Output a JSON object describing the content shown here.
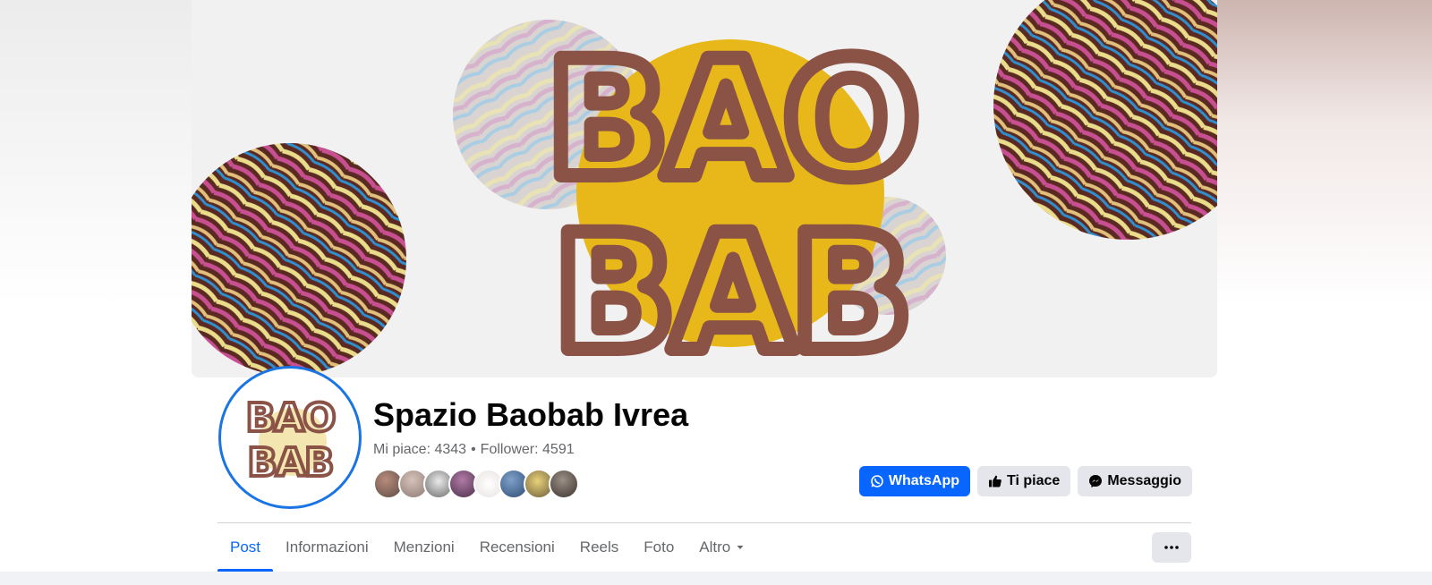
{
  "page": {
    "name": "Spazio Baobab Ivrea",
    "likes_label": "Mi piace: 4343",
    "followers_label": "Follower: 4591",
    "separator": "•"
  },
  "cover": {
    "logo_line1": "BAO",
    "logo_line2": "BAB",
    "colors": {
      "sun": "#e8b81a",
      "letters": "#8b5346",
      "background": "#f1f1f1"
    }
  },
  "avatar": {
    "logo_line1": "BAO",
    "logo_line2": "BAB"
  },
  "actions": {
    "whatsapp": {
      "label": "WhatsApp",
      "icon": "whatsapp-icon"
    },
    "like": {
      "label": "Ti piace",
      "icon": "thumbs-up-icon"
    },
    "message": {
      "label": "Messaggio",
      "icon": "messenger-icon"
    }
  },
  "tabs": [
    {
      "label": "Post",
      "active": true
    },
    {
      "label": "Informazioni",
      "active": false
    },
    {
      "label": "Menzioni",
      "active": false
    },
    {
      "label": "Recensioni",
      "active": false
    },
    {
      "label": "Reels",
      "active": false
    },
    {
      "label": "Foto",
      "active": false
    },
    {
      "label": "Altro",
      "active": false,
      "icon": "caret-down-icon"
    }
  ],
  "more_button": {
    "icon": "ellipsis-icon"
  },
  "colors": {
    "accent": "#0866ff",
    "text": "#050505",
    "muted": "#65676b",
    "button_secondary": "#e4e6eb",
    "avatar_ring": "#1b74e4"
  }
}
